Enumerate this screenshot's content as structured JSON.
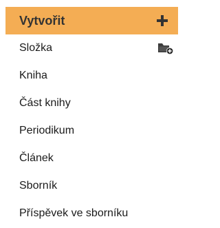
{
  "create_menu": {
    "title": "Vytvořit",
    "toggle_icon": "plus-icon",
    "accent_color": "#f4ad54",
    "items": [
      {
        "label": "Složka",
        "icon": "folder-add-icon"
      },
      {
        "label": "Kniha"
      },
      {
        "label": "Část knihy"
      },
      {
        "label": "Periodikum"
      },
      {
        "label": "Článek"
      },
      {
        "label": "Sborník"
      },
      {
        "label": "Příspěvek ve sborníku"
      }
    ]
  }
}
